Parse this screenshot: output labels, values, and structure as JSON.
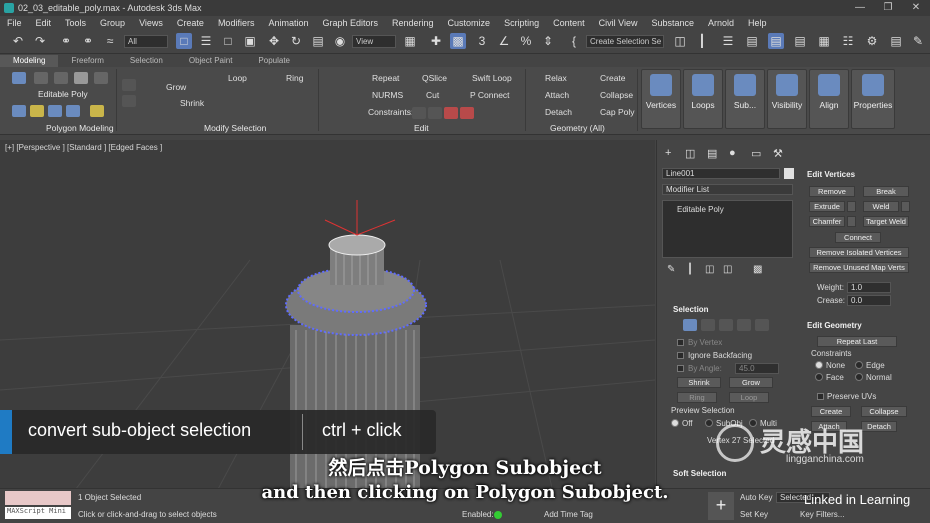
{
  "window": {
    "title": "02_03_editable_poly.max - Autodesk 3ds Max"
  },
  "menu": [
    "File",
    "Edit",
    "Tools",
    "Group",
    "Views",
    "Create",
    "Modifiers",
    "Animation",
    "Graph Editors",
    "Rendering",
    "Customize",
    "Scripting",
    "Content",
    "Civil View",
    "Substance",
    "Arnold",
    "Help"
  ],
  "toolbar": {
    "filter": "All",
    "refcoord": "View",
    "named_set": "Create Selection Se"
  },
  "ribbon_tabs": [
    "Modeling",
    "Freeform",
    "Selection",
    "Object Paint",
    "Populate"
  ],
  "ribbon": {
    "mode_label": "Editable Poly",
    "grow": "Grow",
    "shrink": "Shrink",
    "loop": "Loop",
    "ring": "Ring",
    "repeat": "Repeat",
    "qslice": "QSlice",
    "swift_loop": "Swift Loop",
    "nurms": "NURMS",
    "cut": "Cut",
    "pconnect": "P Connect",
    "constraints": "Constraints:",
    "relax": "Relax",
    "create": "Create",
    "attach": "Attach",
    "collapse": "Collapse",
    "detach": "Detach",
    "cap_poly": "Cap Poly",
    "panel_polymodel": "Polygon Modeling",
    "panel_modsel": "Modify Selection",
    "panel_edit": "Edit",
    "panel_geom": "Geometry (All)",
    "big_buttons": [
      "Vertices",
      "Loops",
      "Sub...",
      "Visibility",
      "Align",
      "Properties"
    ]
  },
  "viewport": {
    "label": "[+] [Perspective ] [Standard ] [Edged Faces ]"
  },
  "command_panel": {
    "object_name": "Line001",
    "modifier_list": "Modifier List",
    "stack_item": "Editable Poly",
    "selection_title": "Selection",
    "by_vertex": "By Vertex",
    "ignore_backfacing": "Ignore Backfacing",
    "by_angle": "By Angle:",
    "angle_value": "45.0",
    "shrink": "Shrink",
    "grow": "Grow",
    "ring": "Ring",
    "loop": "Loop",
    "preview_selection": "Preview Selection",
    "preview_opts": [
      "Off",
      "SubObj",
      "Multi"
    ],
    "vertex_count": "Vertex 27 Selected",
    "soft_selection": "Soft Selection",
    "edit_vertices_title": "Edit Vertices",
    "remove": "Remove",
    "break": "Break",
    "extrude": "Extrude",
    "weld": "Weld",
    "chamfer": "Chamfer",
    "target_weld": "Target Weld",
    "connect": "Connect",
    "remove_isolated": "Remove Isolated Vertices",
    "remove_unused": "Remove Unused Map Verts",
    "weight_label": "Weight:",
    "weight_value": "1.0",
    "crease_label": "Crease:",
    "crease_value": "0.0",
    "edit_geometry_title": "Edit Geometry",
    "repeat_last": "Repeat Last",
    "constraints_title": "Constraints",
    "constraint_opts": [
      "None",
      "Edge",
      "Face",
      "Normal"
    ],
    "preserve_uvs": "Preserve UVs",
    "create": "Create",
    "collapse": "Collapse",
    "attach": "Attach",
    "detach": "Detach"
  },
  "status": {
    "maxscript": "MAXScript Mini",
    "selected": "1 Object Selected",
    "prompt": "Click or click-and-drag to select objects",
    "enabled": "Enabled:",
    "add_time_tag": "Add Time Tag",
    "autokey": "Auto Key",
    "setkey": "Set Key",
    "selected_dd": "Selected",
    "key_filters": "Key Filters..."
  },
  "overlay": {
    "hint_left": "convert sub-object selection",
    "hint_right": "ctrl + click",
    "subtitle_cn": "然后点击Polygon Subobject",
    "subtitle_en": "and then clicking on Polygon Subobject.",
    "watermark_cn": "灵感中国",
    "watermark_url": "lingganchina.com",
    "linkedin": "Linked in Learning"
  }
}
